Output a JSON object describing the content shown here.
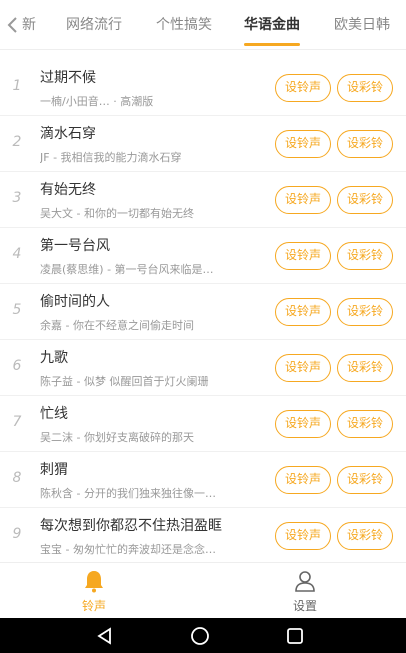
{
  "tabs": {
    "back_label": "新",
    "items": [
      {
        "label": "网络流行"
      },
      {
        "label": "个性搞笑"
      },
      {
        "label": "华语金曲"
      },
      {
        "label": "欧美日韩"
      }
    ],
    "active_index": 2
  },
  "list": {
    "ring_button_label": "设铃声",
    "color_button_label": "设彩铃",
    "items": [
      {
        "num": "1",
        "title": "过期不候",
        "subtitle": "一楠/小田音… · 高潮版"
      },
      {
        "num": "2",
        "title": "滴水石穿",
        "subtitle": "JF - 我相信我的能力滴水石穿"
      },
      {
        "num": "3",
        "title": "有始无终",
        "subtitle": "吴大文 - 和你的一切都有始无终"
      },
      {
        "num": "4",
        "title": "第一号台风",
        "subtitle": "凌晨(蔡思维) - 第一号台风来临是…"
      },
      {
        "num": "5",
        "title": "偷时间的人",
        "subtitle": "余嘉 - 你在不经意之间偷走时间"
      },
      {
        "num": "6",
        "title": "九歌",
        "subtitle": "陈子益 - 似梦 似醒回首于灯火阑珊"
      },
      {
        "num": "7",
        "title": "忙线",
        "subtitle": "吴二沫 - 你划好支离破碎的那天"
      },
      {
        "num": "8",
        "title": "刺猬",
        "subtitle": "陈秋含 - 分开的我们独来独往像一…"
      },
      {
        "num": "9",
        "title": "每次想到你都忍不住热泪盈眶",
        "subtitle": "宝宝 - 匆匆忙忙的奔波却还是念念…"
      }
    ]
  },
  "bottom_nav": {
    "ringtone_label": "铃声",
    "settings_label": "设置"
  },
  "colors": {
    "accent": "#f6a821"
  },
  "icons": {
    "back": "chevron-left-icon",
    "ringtone": "bell-icon",
    "settings": "user-icon",
    "sys_back": "triangle-back-icon",
    "sys_home": "circle-home-icon",
    "sys_recents": "square-recents-icon"
  }
}
